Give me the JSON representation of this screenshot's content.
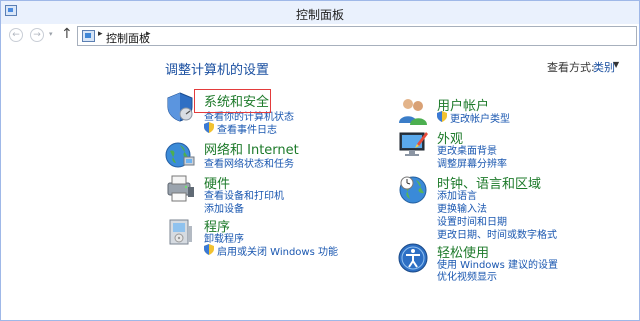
{
  "window": {
    "title": "控制面板"
  },
  "address": {
    "crumb": "控制面板",
    "sep1": "▸",
    "sep2": "▸"
  },
  "nav": {
    "back": "←",
    "forward": "→",
    "dropdown": "▾",
    "up": "↑"
  },
  "page": {
    "heading": "调整计算机的设置"
  },
  "view": {
    "label": "查看方式:",
    "value": "类别",
    "arrow": "▼"
  },
  "left": [
    {
      "title": "系统和安全",
      "links": [
        "查看你的计算机状态",
        "查看事件日志"
      ],
      "shield": [
        false,
        true
      ]
    },
    {
      "title": "网络和 Internet",
      "links": [
        "查看网络状态和任务"
      ],
      "shield": [
        false
      ]
    },
    {
      "title": "硬件",
      "links": [
        "查看设备和打印机",
        "添加设备"
      ],
      "shield": [
        false,
        false
      ]
    },
    {
      "title": "程序",
      "links": [
        "卸载程序",
        "启用或关闭 Windows 功能"
      ],
      "shield": [
        false,
        true
      ]
    }
  ],
  "right": [
    {
      "title": "用户帐户",
      "links": [
        "更改帐户类型"
      ],
      "shield": [
        true
      ]
    },
    {
      "title": "外观",
      "links": [
        "更改桌面背景",
        "调整屏幕分辨率"
      ],
      "shield": [
        false,
        false
      ]
    },
    {
      "title": "时钟、语言和区域",
      "links": [
        "添加语言",
        "更换输入法",
        "设置时间和日期",
        "更改日期、时间或数字格式"
      ],
      "shield": [
        false,
        false,
        false,
        false
      ]
    },
    {
      "title": "轻松使用",
      "links": [
        "使用 Windows 建议的设置",
        "优化视频显示"
      ],
      "shield": [
        false,
        false
      ]
    }
  ]
}
